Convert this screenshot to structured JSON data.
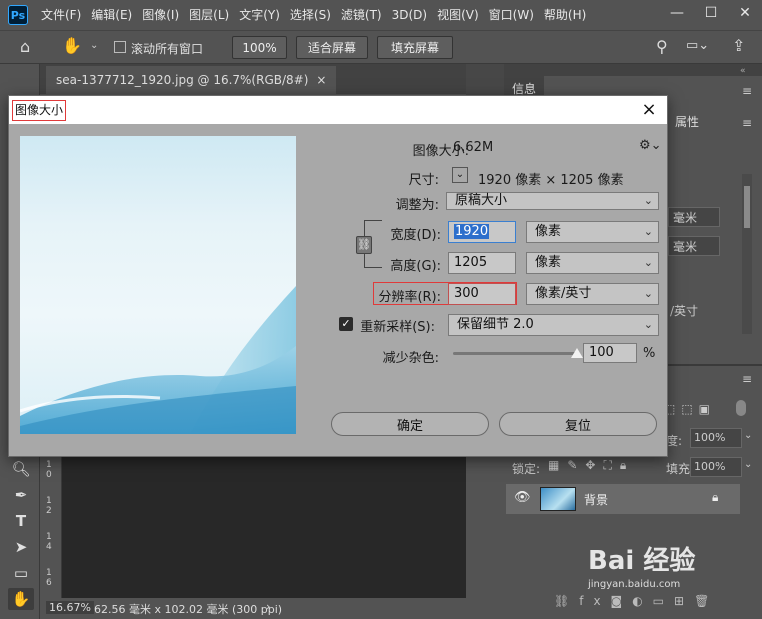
{
  "menubar": {
    "logo": "Ps",
    "items": [
      "文件(F)",
      "编辑(E)",
      "图像(I)",
      "图层(L)",
      "文字(Y)",
      "选择(S)",
      "滤镜(T)",
      "3D(D)",
      "视图(V)",
      "窗口(W)",
      "帮助(H)"
    ]
  },
  "optionsbar": {
    "scroll_all_label": "滚动所有窗口",
    "zoom_100": "100%",
    "fit_screen": "适合屏幕",
    "fill_screen": "填充屏幕"
  },
  "document": {
    "tab_title": "sea-1377712_1920.jpg @ 16.7%(RGB/8#)",
    "tab_close": "×",
    "ruler_numbers": [
      "1",
      "0",
      "1",
      "2",
      "1",
      "4",
      "1",
      "6"
    ],
    "status_zoom": "16.67%",
    "status_info": "62.56 毫米 x 102.02 毫米 (300 ppi)"
  },
  "right_panel": {
    "info_tab": "信息",
    "properties_tab": "属性",
    "unit_1": "毫米",
    "unit_2": "毫米",
    "unit_3": "/英寸",
    "opacity_label": "度:",
    "opacity_value": "100%",
    "lock_label": "锁定:",
    "fill_label": "填充:",
    "fill_value": "100%",
    "layer_name": "背景"
  },
  "dialog": {
    "title": "图像大小",
    "close": "×",
    "image_size_label": "图像大小:",
    "image_size_value": "6.62M",
    "dimensions_label": "尺寸:",
    "dimensions_value": "1920 像素  ×  1205 像素",
    "fit_to_label": "调整为:",
    "fit_to_value": "原稿大小",
    "width_label": "宽度(D):",
    "width_value": "1920",
    "width_unit": "像素",
    "height_label": "高度(G):",
    "height_value": "1205",
    "height_unit": "像素",
    "resolution_label": "分辨率(R):",
    "resolution_value": "300",
    "resolution_unit": "像素/英寸",
    "resample_label": "重新采样(S):",
    "resample_value": "保留细节 2.0",
    "noise_label": "减少杂色:",
    "noise_value": "100",
    "noise_unit": "%",
    "noise_level": 1.0,
    "ok": "确定",
    "reset": "复位"
  },
  "watermark": {
    "text": "Bai  经验",
    "sub": "jingyan.baidu.com"
  }
}
